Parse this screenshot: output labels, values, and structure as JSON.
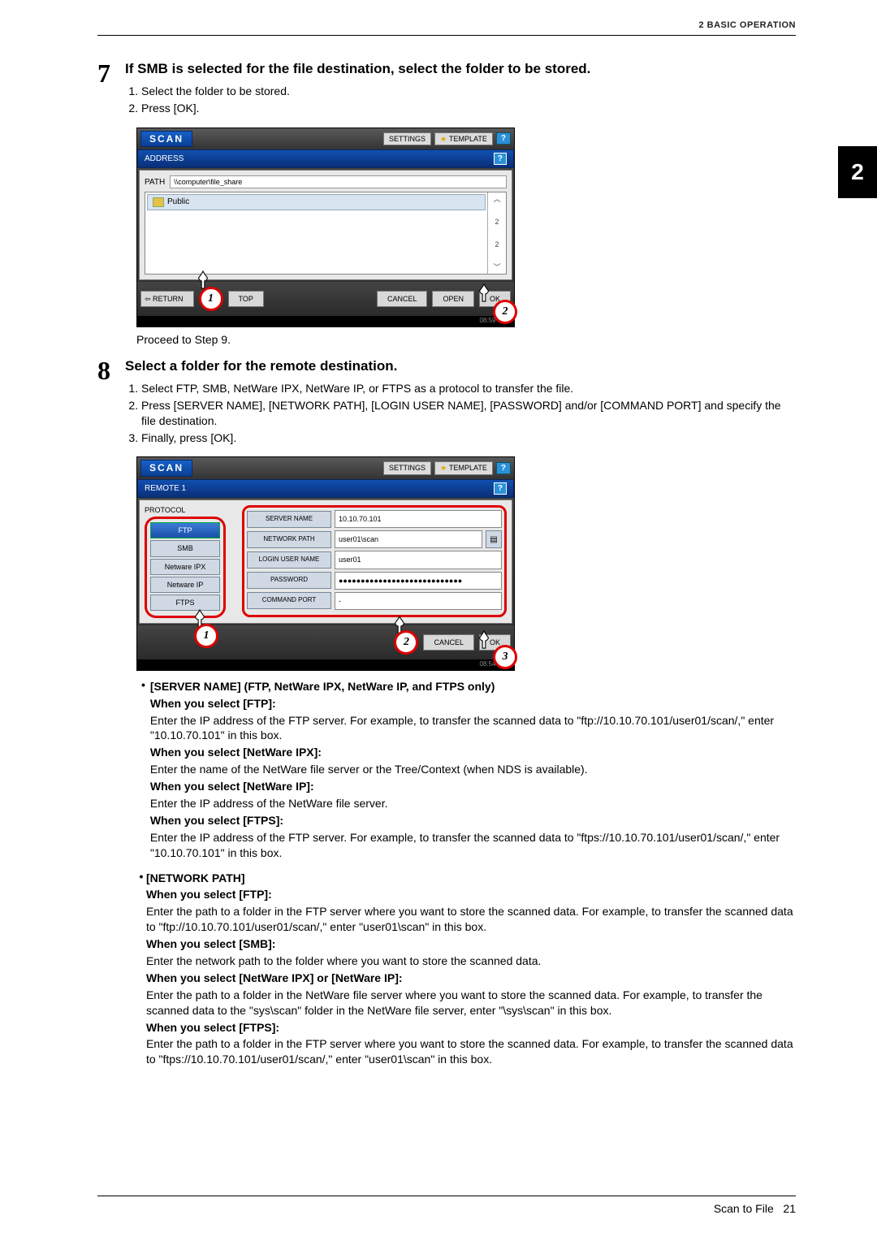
{
  "header": "2 BASIC OPERATION",
  "sideTab": "2",
  "step7": {
    "num": "7",
    "title": "If SMB is selected for the file destination, select the folder to be stored.",
    "items": [
      "Select the folder to be stored.",
      "Press [OK]."
    ],
    "proceed": "Proceed to Step 9."
  },
  "step8": {
    "num": "8",
    "title": "Select a folder for the remote destination.",
    "items": [
      "Select FTP, SMB, NetWare IPX, NetWare IP, or FTPS as a protocol to transfer the file.",
      "Press [SERVER NAME], [NETWORK PATH], [LOGIN USER NAME], [PASSWORD] and/or [COMMAND PORT] and specify the file destination.",
      "Finally, press [OK]."
    ]
  },
  "shot1": {
    "scan": "SCAN",
    "settings": "SETTINGS",
    "template": "TEMPLATE",
    "q": "?",
    "bar": "ADDRESS",
    "pathLbl": "PATH",
    "path": "\\\\computer\\file_share",
    "folder": "Public",
    "pg1": "2",
    "pg2": "2",
    "up": "︿",
    "dn": "﹀",
    "return": "RETURN",
    "top": "TOP",
    "cancel": "CANCEL",
    "open": "OPEN",
    "ok": "OK",
    "c1": "1",
    "c2": "2",
    "time": "08:59"
  },
  "shot2": {
    "scan": "SCAN",
    "settings": "SETTINGS",
    "template": "TEMPLATE",
    "q": "?",
    "bar": "REMOTE 1",
    "protoLbl": "PROTOCOL",
    "p": [
      "FTP",
      "SMB",
      "Netware IPX",
      "Netware IP",
      "FTPS"
    ],
    "f": [
      {
        "l": "SERVER NAME",
        "v": "10.10.70.101"
      },
      {
        "l": "NETWORK PATH",
        "v": "user01\\scan"
      },
      {
        "l": "LOGIN USER NAME",
        "v": "user01"
      },
      {
        "l": "PASSWORD",
        "v": "●●●●●●●●●●●●●●●●●●●●●●●●●●●●"
      },
      {
        "l": "COMMAND PORT",
        "v": "-"
      }
    ],
    "cancel": "CANCEL",
    "ok": "OK",
    "c1": "1",
    "c2": "2",
    "c3": "3",
    "time": "08:54"
  },
  "desc": {
    "sn_head": "[SERVER NAME] (FTP, NetWare IPX, NetWare IP, and FTPS only)",
    "ftpH": "When you select [FTP]:",
    "ftpT": "Enter the IP address of the FTP server. For example, to transfer the scanned data to \"ftp://10.10.70.101/user01/scan/,\" enter \"10.10.70.101\" in this box.",
    "nipxH": "When you select [NetWare IPX]:",
    "nipxT": "Enter the name of the NetWare file server or the Tree/Context (when NDS is available).",
    "nipH": "When you select [NetWare IP]:",
    "nipT": "Enter the IP address of the NetWare file server.",
    "ftpsH": "When you select [FTPS]:",
    "ftpsT": "Enter the IP address of the FTP server. For example, to transfer the scanned data to \"ftps://10.10.70.101/user01/scan/,\" enter \"10.10.70.101\" in this box.",
    "np_head": "[NETWORK PATH]",
    "np_ftpH": "When you select [FTP]:",
    "np_ftpT": "Enter the path to a folder in the FTP server where you want to store the scanned data. For example, to transfer the scanned data to \"ftp://10.10.70.101/user01/scan/,\" enter \"user01\\scan\" in this box.",
    "np_smbH": "When you select [SMB]:",
    "np_smbT": "Enter the network path to the folder where you want to store the scanned data.",
    "np_nwH": "When you select [NetWare IPX] or [NetWare IP]:",
    "np_nwT": "Enter the path to a folder in the NetWare file server where you want to store the scanned data. For example, to transfer the scanned data to the \"sys\\scan\" folder in the NetWare file server, enter \"\\sys\\scan\" in this box.",
    "np_ftpsH": "When you select [FTPS]:",
    "np_ftpsT": "Enter the path to a folder in the FTP server where you want to store the scanned data. For example, to transfer the scanned data to \"ftps://10.10.70.101/user01/scan/,\" enter \"user01\\scan\" in this box."
  },
  "footer": {
    "title": "Scan to File",
    "page": "21"
  }
}
